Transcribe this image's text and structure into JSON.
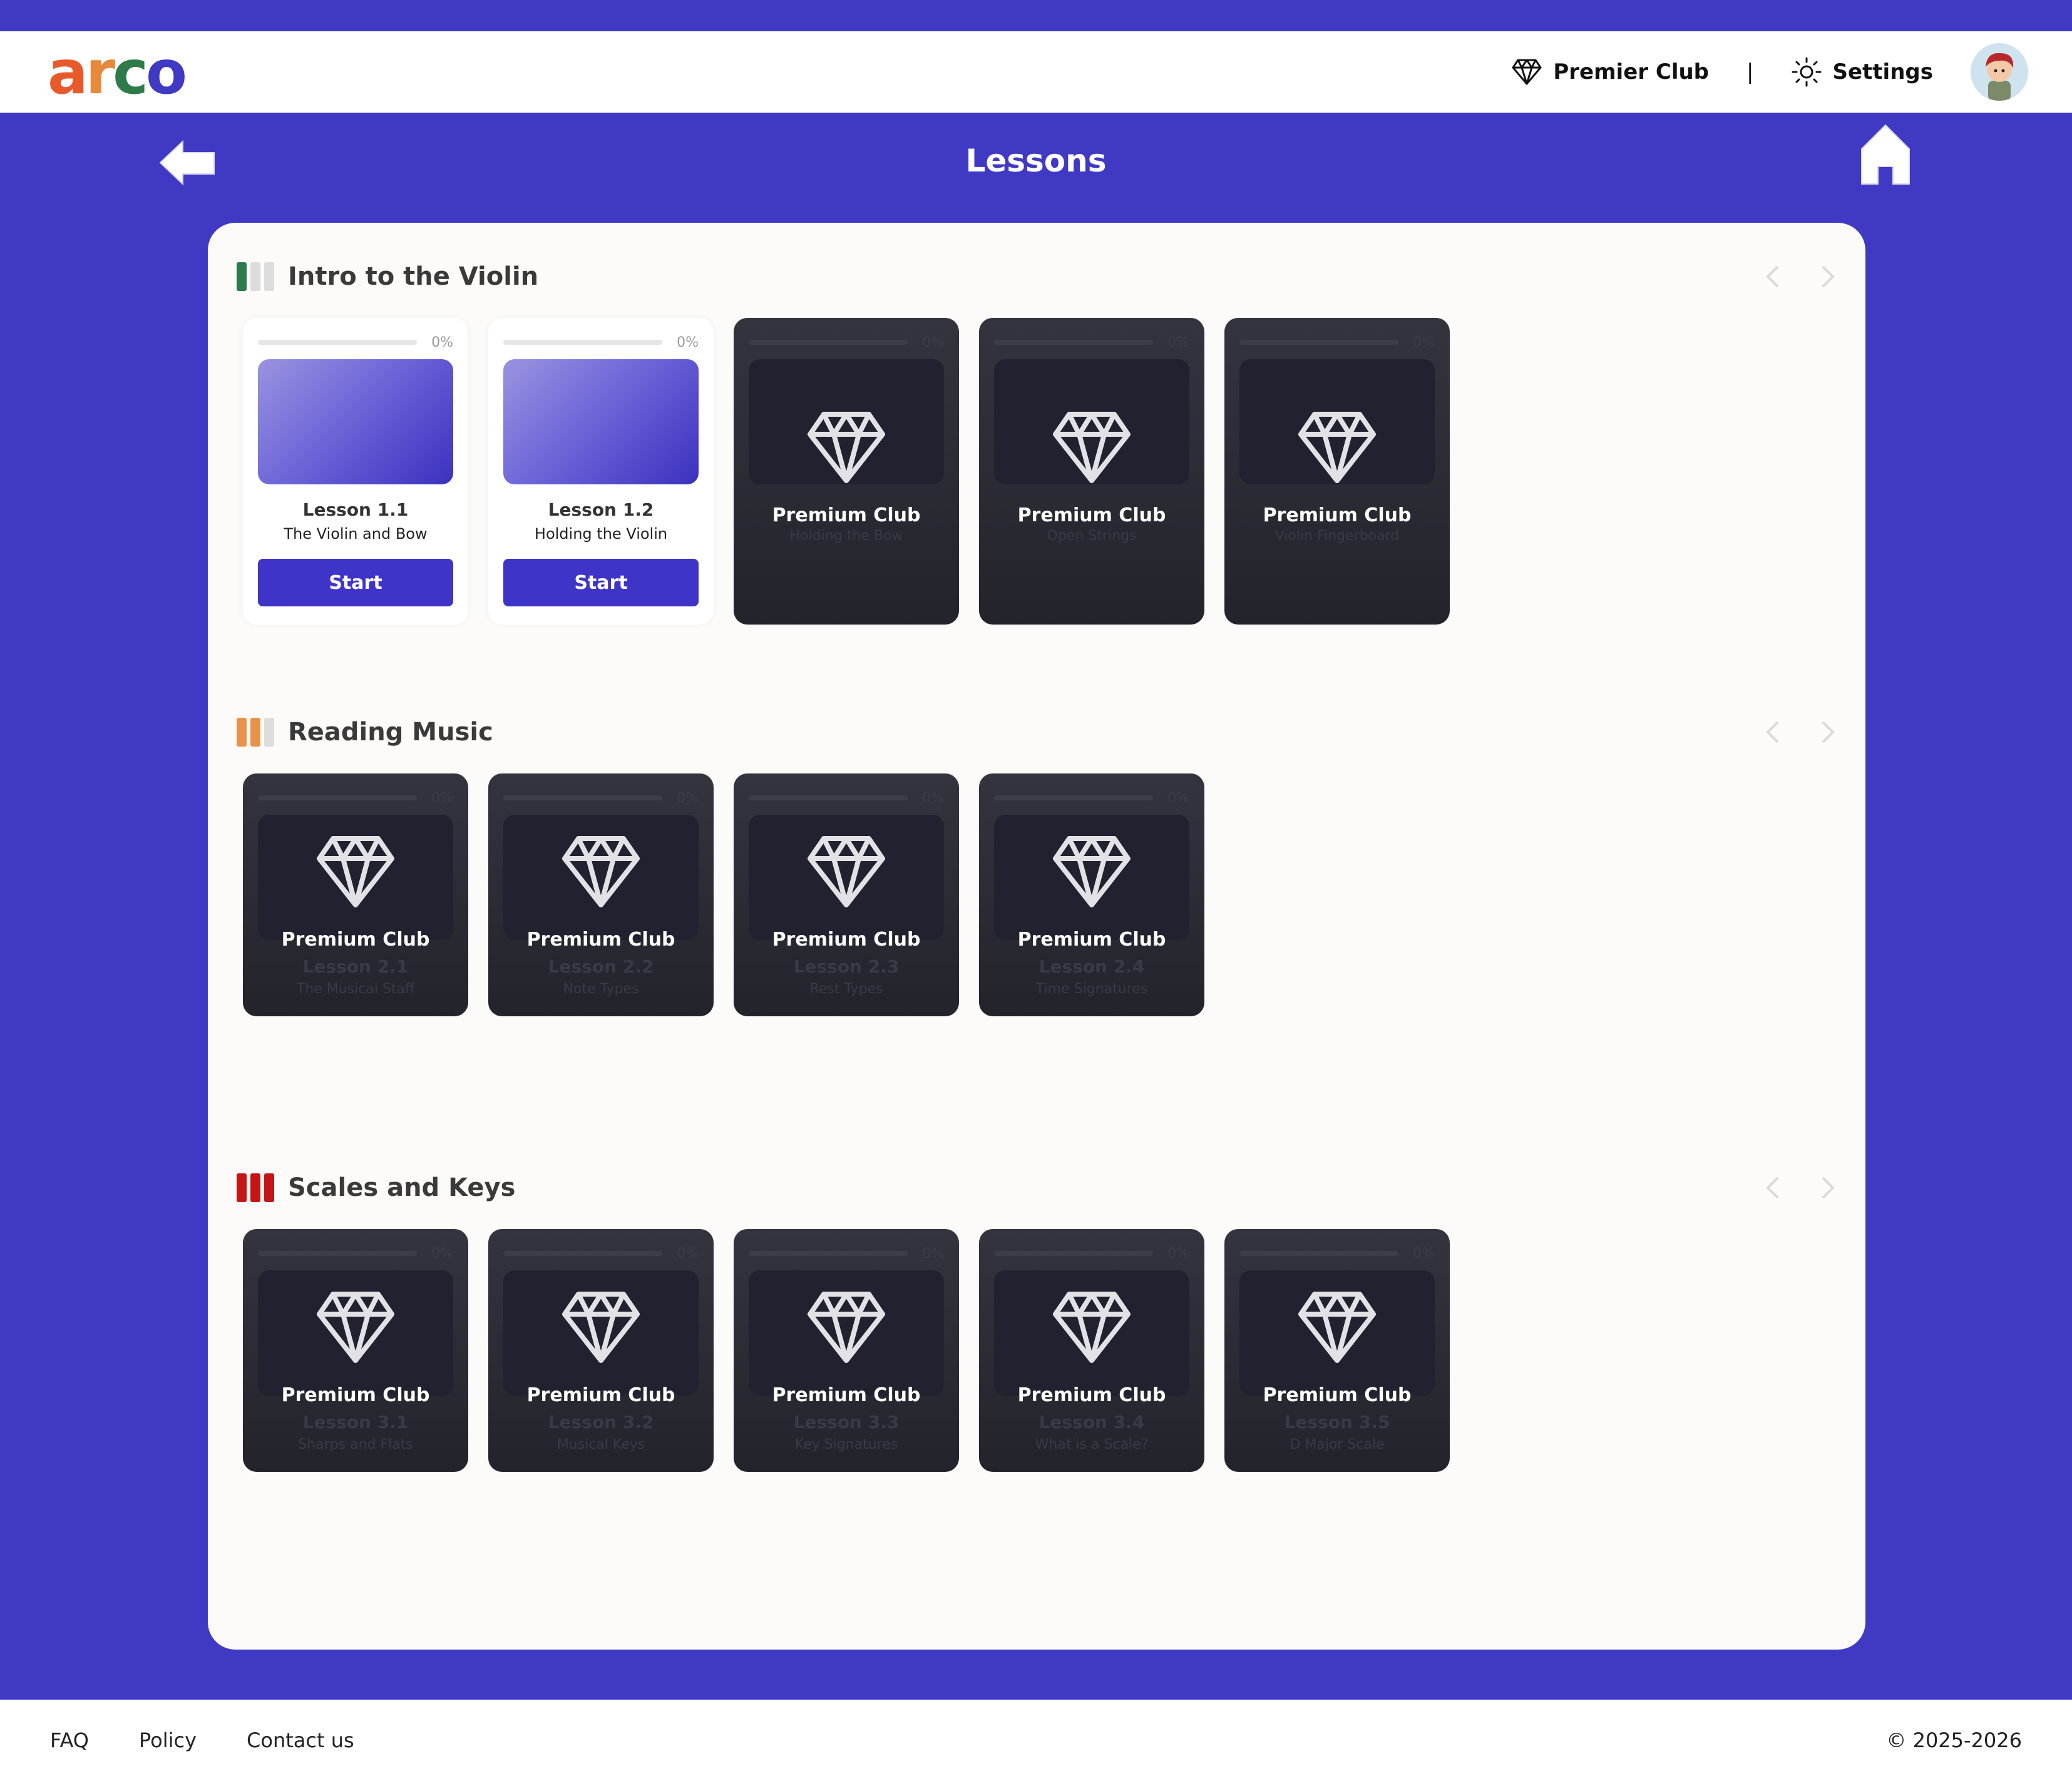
{
  "header": {
    "logo_letters": [
      "a",
      "r",
      "c",
      "o"
    ],
    "logo_colors": [
      "#e85a2a",
      "#e8883a",
      "#2f7a4a",
      "#3f39c4"
    ],
    "premier_label": "Premier Club",
    "separator": "|",
    "settings_label": "Settings"
  },
  "page": {
    "title": "Lessons"
  },
  "sections": [
    {
      "title": "Intro to the Violin",
      "bar_colors": [
        "#2e7a4c",
        "#dcdcdc",
        "#dcdcdc"
      ],
      "lessons": [
        {
          "number": "Lesson 1.1",
          "name": "The Violin and Bow",
          "progress": "0%",
          "locked": false,
          "button": "Start"
        },
        {
          "number": "Lesson 1.2",
          "name": "Holding the Violin",
          "progress": "0%",
          "locked": false,
          "button": "Start"
        },
        {
          "number": "",
          "name": "Holding the Bow",
          "progress": "0%",
          "locked": true,
          "label": "Premium Club"
        },
        {
          "number": "",
          "name": "Open Strings",
          "progress": "0%",
          "locked": true,
          "label": "Premium Club"
        },
        {
          "number": "",
          "name": "Violin Fingerboard",
          "progress": "0%",
          "locked": true,
          "label": "Premium Club"
        }
      ]
    },
    {
      "title": "Reading Music",
      "bar_colors": [
        "#e8924a",
        "#e8924a",
        "#dcdcdc"
      ],
      "lessons": [
        {
          "number": "Lesson 2.1",
          "name": "The Musical Staff",
          "progress": "0%",
          "locked": true,
          "label": "Premium Club"
        },
        {
          "number": "Lesson 2.2",
          "name": "Note Types",
          "progress": "0%",
          "locked": true,
          "label": "Premium Club"
        },
        {
          "number": "Lesson 2.3",
          "name": "Rest Types",
          "progress": "0%",
          "locked": true,
          "label": "Premium Club"
        },
        {
          "number": "Lesson 2.4",
          "name": "Time Signatures",
          "progress": "0%",
          "locked": true,
          "label": "Premium Club"
        }
      ]
    },
    {
      "title": "Scales and Keys",
      "bar_colors": [
        "#c41616",
        "#c41616",
        "#c41616"
      ],
      "lessons": [
        {
          "number": "Lesson 3.1",
          "name": "Sharps and Flats",
          "progress": "0%",
          "locked": true,
          "label": "Premium Club"
        },
        {
          "number": "Lesson 3.2",
          "name": "Musical Keys",
          "progress": "0%",
          "locked": true,
          "label": "Premium Club"
        },
        {
          "number": "Lesson 3.3",
          "name": "Key Signatures",
          "progress": "0%",
          "locked": true,
          "label": "Premium Club"
        },
        {
          "number": "Lesson 3.4",
          "name": "What is a Scale?",
          "progress": "0%",
          "locked": true,
          "label": "Premium Club"
        },
        {
          "number": "Lesson 3.5",
          "name": "D Major Scale",
          "progress": "0%",
          "locked": true,
          "label": "Premium Club"
        }
      ]
    }
  ],
  "footer": {
    "links": [
      "FAQ",
      "Policy",
      "Contact us"
    ],
    "copyright": "© 2025-2026"
  },
  "colors": {
    "brand": "#3f39c4",
    "button": "#3f34c8"
  }
}
